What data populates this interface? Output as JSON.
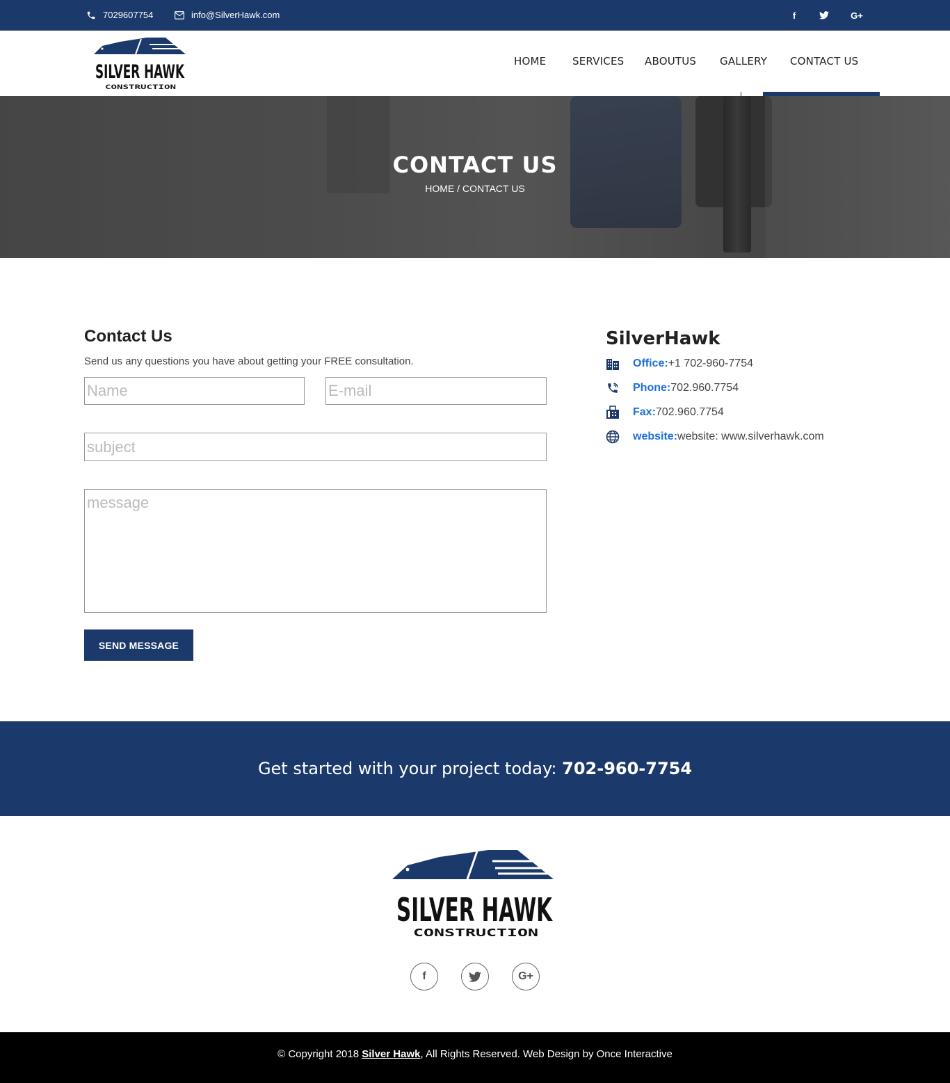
{
  "topbar": {
    "phone": "7029607754",
    "email": "info@SilverHawk.com",
    "social": {
      "facebook": "f",
      "twitter": "t",
      "google": "G+"
    }
  },
  "brand": {
    "line1": "SILVER HAWK",
    "line2": "CONSTRUCTION"
  },
  "nav": {
    "items": [
      {
        "label": "HOME"
      },
      {
        "label": "SERVICES"
      },
      {
        "label": "ABOUTUS"
      },
      {
        "label": "GALLERY"
      },
      {
        "label": "CONTACT US"
      }
    ],
    "active": "CONTACT US"
  },
  "banner": {
    "title": "CONTACT US",
    "breadcrumb": "HOME / CONTACT US"
  },
  "contact_form": {
    "title": "Contact Us",
    "description": "Send us any questions you have about getting your FREE consultation.",
    "name_placeholder": "Name",
    "email_placeholder": "E-mail",
    "subject_placeholder": "subject",
    "message_placeholder": "message",
    "submit_label": "SEND MESSAGE"
  },
  "info": {
    "title": "SilverHawk",
    "office_label": "Office:",
    "office_value": "+1 702-960-7754",
    "phone_label": "Phone:",
    "phone_value": " 702.960.7754",
    "fax_label": "Fax:",
    "fax_value": " 702.960.7754",
    "website_label": "website:",
    "website_value": "website: www.silverhawk.com"
  },
  "cta": {
    "text": "Get started with your project today: ",
    "number": "702-960-7754"
  },
  "footer": {
    "social": {
      "facebook": "f",
      "twitter": "t",
      "google": "G+"
    },
    "copyright_prefix": "© Copyright 2018 ",
    "copyright_link": "Silver Hawk",
    "copyright_suffix": ", All Rights Reserved. Web Design by Once Interactive"
  },
  "colors": {
    "brand_navy": "#1b3a6b",
    "link_blue": "#1e6fd9",
    "footer_bg": "#000000"
  }
}
